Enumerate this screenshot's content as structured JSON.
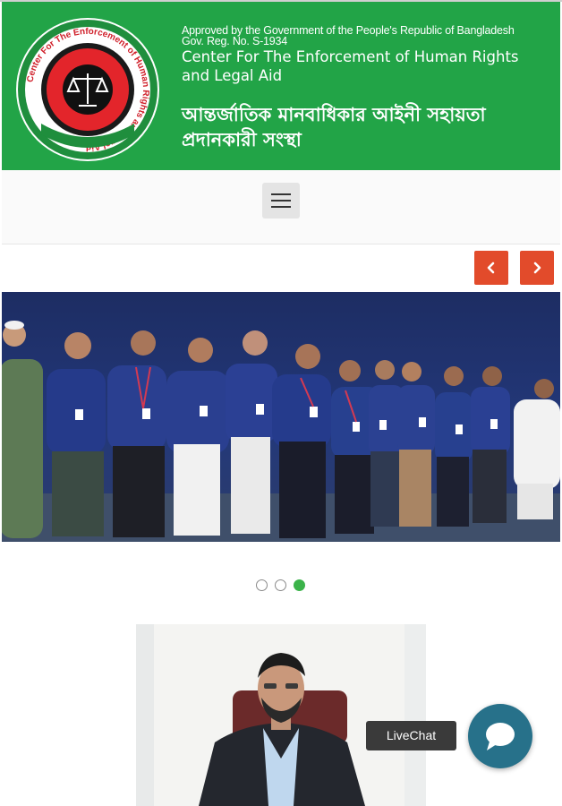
{
  "header": {
    "logo_ring_text": "Center For The Enforcement of Human Rights and Legal Aid",
    "approved_line": "Approved by the Government of the People's Republic of Bangladesh",
    "reg_line": "Gov. Reg. No. S-1934",
    "org_name_en": "Center For The Enforcement of Human Rights and Legal Aid",
    "org_name_bn": "আন্তর্জাতিক মানবাধিকার আইনী সহায়তা প্রদানকারী সংস্থা",
    "brand_color": "#22a447"
  },
  "nav": {
    "menu_icon": "hamburger-icon"
  },
  "slider": {
    "prev_icon": "chevron-left-icon",
    "next_icon": "chevron-right-icon",
    "arrow_color": "#e24b2b",
    "slide_count": 3,
    "active_slide": 3,
    "active_dot_color": "#3bb34a"
  },
  "livechat": {
    "label": "LiveChat",
    "icon": "chat-bubble-icon",
    "button_color": "#27718a"
  }
}
